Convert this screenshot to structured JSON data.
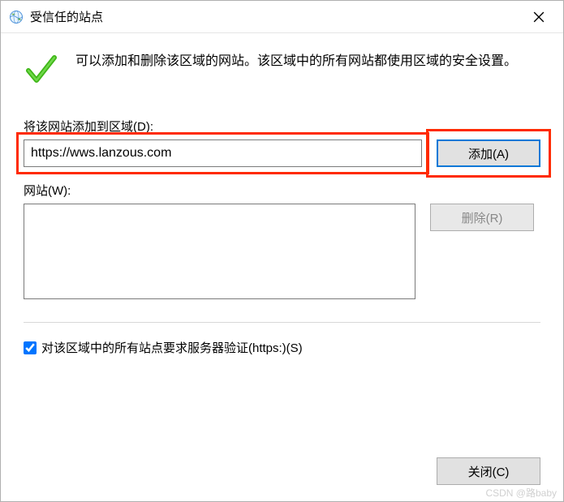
{
  "window": {
    "title": "受信任的站点"
  },
  "header": {
    "description": "可以添加和删除该区域的网站。该区域中的所有网站都使用区域的安全设置。"
  },
  "form": {
    "add_label": "将该网站添加到区域(D):",
    "url_value": "https://wws.lanzous.com",
    "add_button": "添加(A)",
    "sites_label": "网站(W):",
    "remove_button": "删除(R)",
    "https_checkbox_label": "对该区域中的所有站点要求服务器验证(https:)(S)"
  },
  "footer": {
    "close_button": "关闭(C)"
  },
  "watermark": "CSDN @路baby"
}
